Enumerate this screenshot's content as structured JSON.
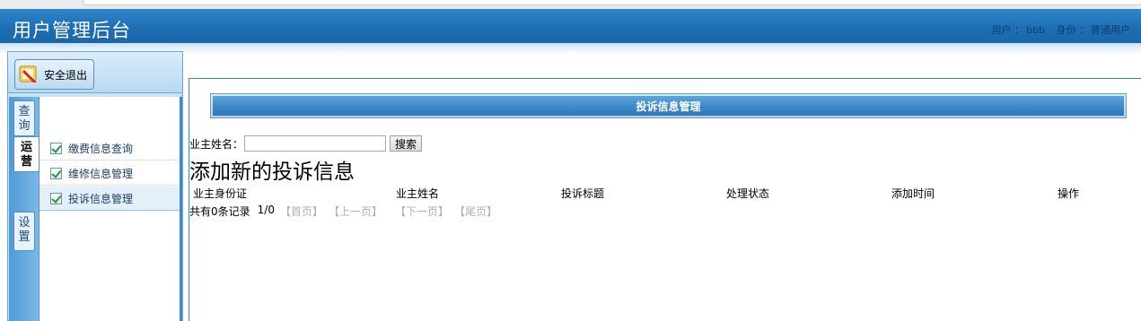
{
  "header": {
    "app_title": "用户管理后台",
    "user_label": "用户 ：",
    "user_name": "bbb",
    "role_label": "身份 ：",
    "role_name": "普通用户"
  },
  "sidebar": {
    "logout_label": "安全退出",
    "tabs": [
      {
        "label": "查询",
        "chars": [
          "查",
          "询"
        ],
        "active": false
      },
      {
        "label": "运营",
        "chars": [
          "运",
          "营"
        ],
        "active": true
      },
      {
        "label": "设置",
        "chars": [
          "设",
          "置"
        ],
        "active": false
      }
    ],
    "menu_items": [
      {
        "label": "缴费信息查询",
        "active": false
      },
      {
        "label": "维修信息管理",
        "active": false
      },
      {
        "label": "投诉信息管理",
        "active": true
      }
    ]
  },
  "main": {
    "section_title": "投诉信息管理",
    "search": {
      "label": "业主姓名：",
      "value": "",
      "button_label": "搜索"
    },
    "add_link": "添加新的投诉信息",
    "table": {
      "columns": [
        "业主身份证",
        "业主姓名",
        "投诉标题",
        "处理状态",
        "添加时间",
        "操作"
      ],
      "rows": []
    },
    "pager": {
      "count_text": "共有0条记录",
      "page_text": "1/0",
      "first": "【首页】",
      "prev": "【上一页】",
      "next": "【下一页】",
      "last": "【尾页】"
    }
  },
  "colors": {
    "header_blue": "#1e6fb5",
    "section_blue": "#3d86c8",
    "disabled_link": "#b0b0b0"
  }
}
